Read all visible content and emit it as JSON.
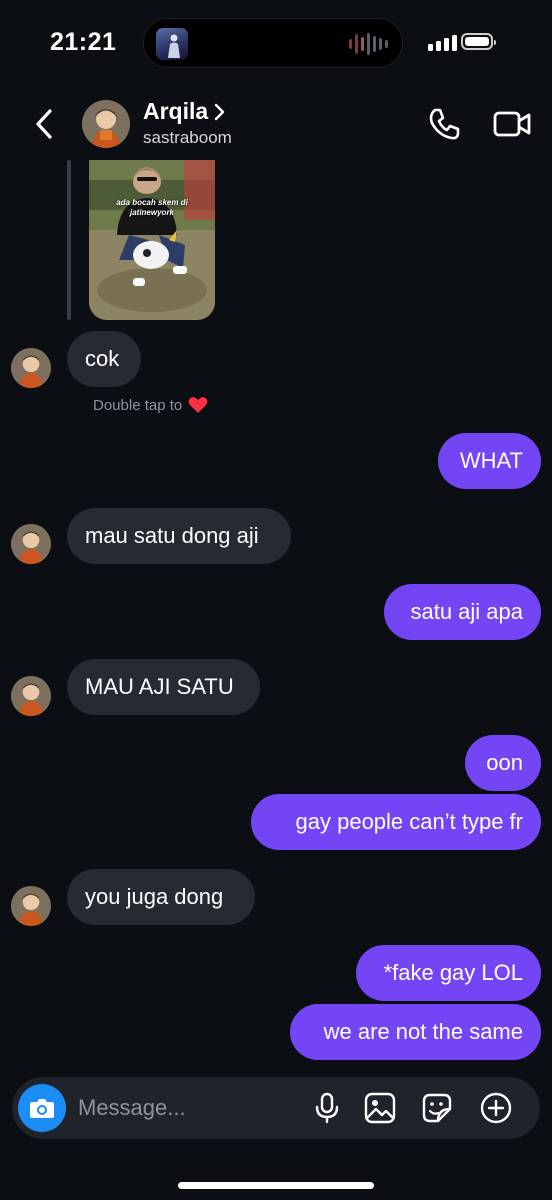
{
  "status_bar": {
    "time": "21:21"
  },
  "header": {
    "name": "Arqila",
    "username": "sastraboom"
  },
  "shared_photo": {
    "caption_line1": "ada bocah skem di",
    "caption_line2": "jatinewyork"
  },
  "messages": [
    {
      "direction": "in",
      "text": "cok"
    },
    {
      "direction": "out",
      "text": "WHAT"
    },
    {
      "direction": "in",
      "text": "mau satu dong aji"
    },
    {
      "direction": "out",
      "text": "satu aji apa"
    },
    {
      "direction": "in",
      "text": "MAU AJI SATU"
    },
    {
      "direction": "out",
      "text": "oon"
    },
    {
      "direction": "out",
      "text": "gay people can’t type fr"
    },
    {
      "direction": "in",
      "text": "you juga dong"
    },
    {
      "direction": "out",
      "text": "*fake gay LOL"
    },
    {
      "direction": "out",
      "text": "we are not the same"
    }
  ],
  "double_tap_hint": "Double tap to",
  "composer": {
    "placeholder": "Message..."
  },
  "colors": {
    "outgoing_bubble": "#7445f5",
    "incoming_bubble": "#262a31",
    "camera_button": "#1c8cf6",
    "background": "#0b0e12"
  }
}
